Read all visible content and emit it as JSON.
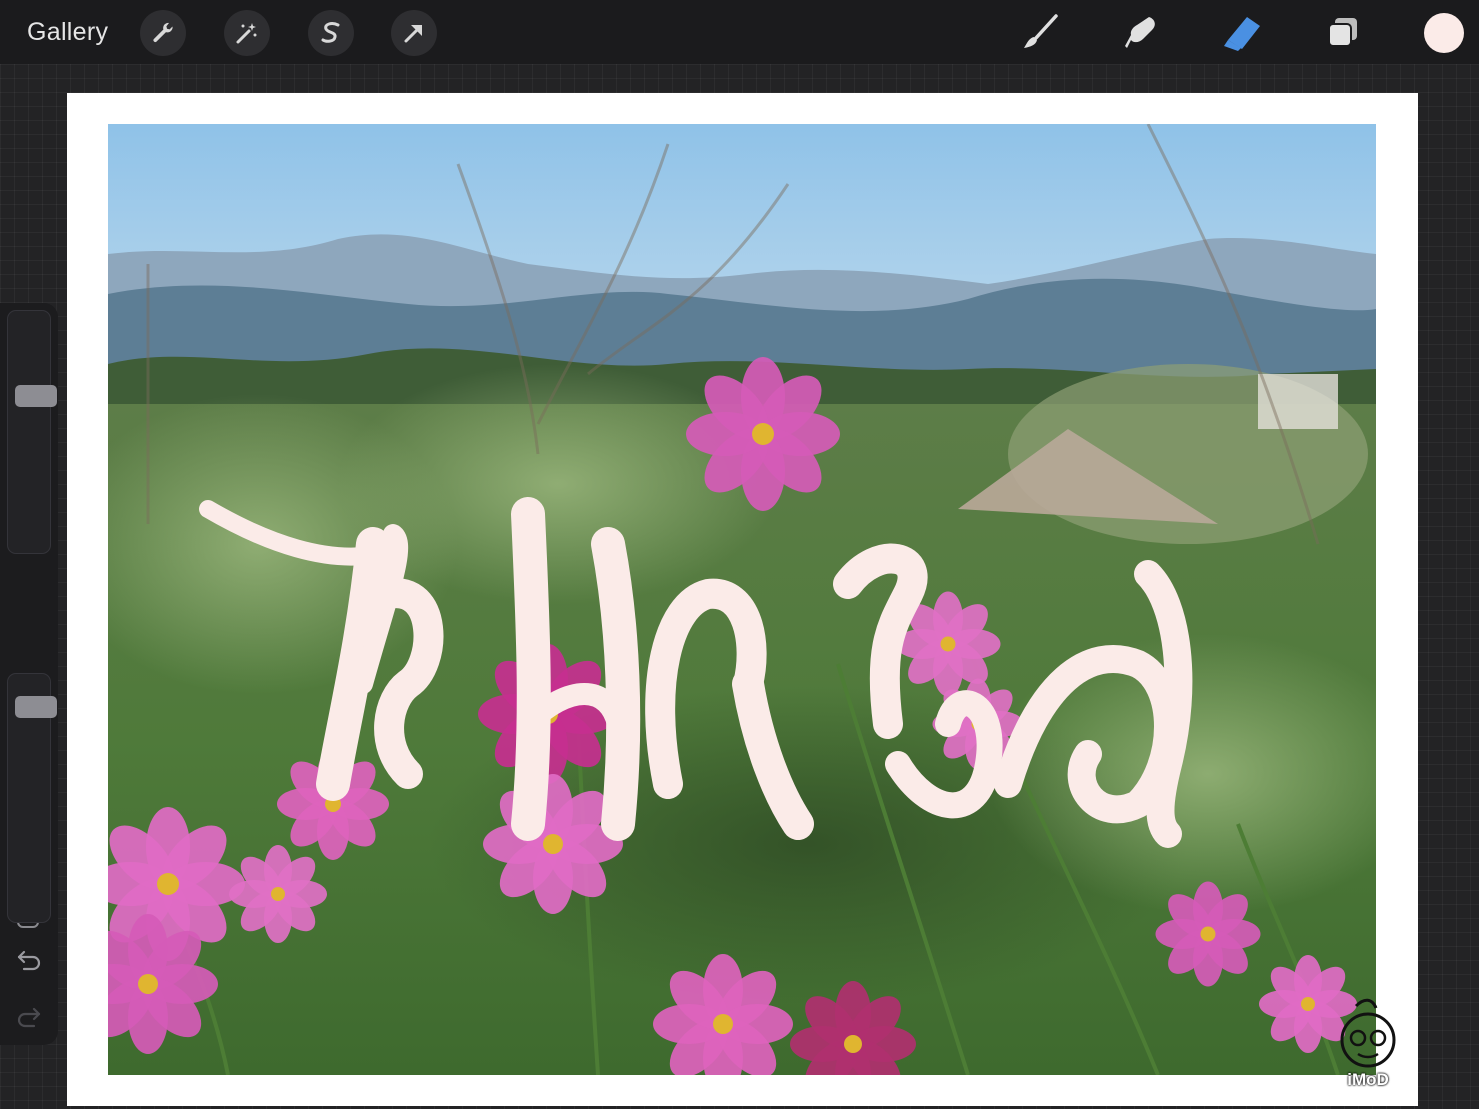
{
  "toolbar": {
    "gallery_label": "Gallery",
    "left_tools": [
      "wrench-icon",
      "magic-wand-icon",
      "selection-icon",
      "transform-arrow-icon"
    ],
    "right_tools": [
      "brush-icon",
      "smudge-icon",
      "eraser-icon",
      "layers-icon"
    ],
    "active_tool": "eraser-icon",
    "active_color": "#4a90e2",
    "current_color": "#fbebe8"
  },
  "sidebar": {
    "brush_size_level": 0.66,
    "opacity_level": 0.9,
    "undo_icon": "undo-icon",
    "redo_icon": "redo-icon"
  },
  "canvas": {
    "lettering_color": "#fbebe8",
    "watermark_text": "iMoD"
  }
}
